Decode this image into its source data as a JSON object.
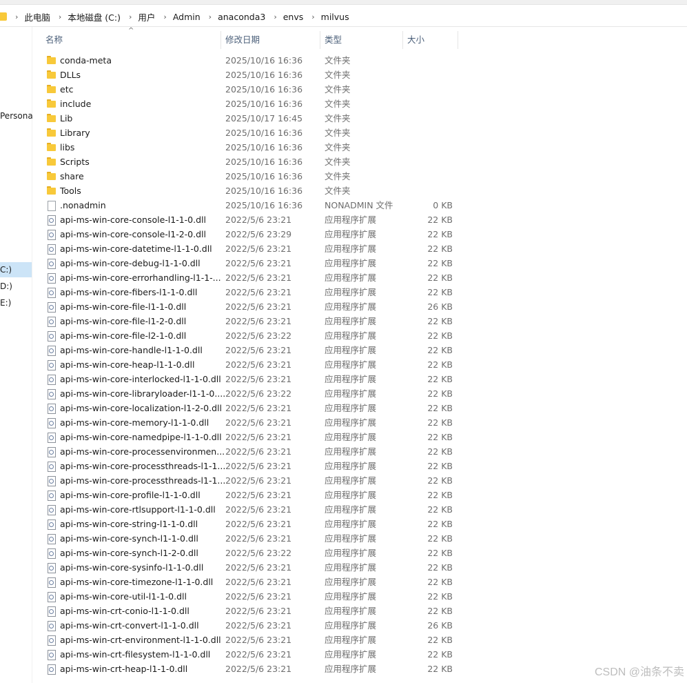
{
  "breadcrumb": [
    "此电脑",
    "本地磁盘 (C:)",
    "用户",
    "Admin",
    "anaconda3",
    "envs",
    "milvus"
  ],
  "nav": {
    "personal": "Persona",
    "drive_c": "C:)",
    "drive_d": "D:)",
    "drive_e": "E:)"
  },
  "columns": {
    "name": "名称",
    "date": "修改日期",
    "type": "类型",
    "size": "大小"
  },
  "rows": [
    {
      "icon": "folder-icon",
      "name": "conda-meta",
      "date": "2025/10/16 16:36",
      "type": "文件夹",
      "size": ""
    },
    {
      "icon": "folder-icon",
      "name": "DLLs",
      "date": "2025/10/16 16:36",
      "type": "文件夹",
      "size": ""
    },
    {
      "icon": "folder-icon",
      "name": "etc",
      "date": "2025/10/16 16:36",
      "type": "文件夹",
      "size": ""
    },
    {
      "icon": "folder-icon",
      "name": "include",
      "date": "2025/10/16 16:36",
      "type": "文件夹",
      "size": ""
    },
    {
      "icon": "folder-icon",
      "name": "Lib",
      "date": "2025/10/17 16:45",
      "type": "文件夹",
      "size": ""
    },
    {
      "icon": "folder-icon",
      "name": "Library",
      "date": "2025/10/16 16:36",
      "type": "文件夹",
      "size": ""
    },
    {
      "icon": "folder-icon",
      "name": "libs",
      "date": "2025/10/16 16:36",
      "type": "文件夹",
      "size": ""
    },
    {
      "icon": "folder-icon",
      "name": "Scripts",
      "date": "2025/10/16 16:36",
      "type": "文件夹",
      "size": ""
    },
    {
      "icon": "folder-icon",
      "name": "share",
      "date": "2025/10/16 16:36",
      "type": "文件夹",
      "size": ""
    },
    {
      "icon": "folder-icon",
      "name": "Tools",
      "date": "2025/10/16 16:36",
      "type": "文件夹",
      "size": ""
    },
    {
      "icon": "file-icon",
      "name": ".nonadmin",
      "date": "2025/10/16 16:36",
      "type": "NONADMIN 文件",
      "size": "0 KB"
    },
    {
      "icon": "dll-icon",
      "name": "api-ms-win-core-console-l1-1-0.dll",
      "date": "2022/5/6 23:21",
      "type": "应用程序扩展",
      "size": "22 KB"
    },
    {
      "icon": "dll-icon",
      "name": "api-ms-win-core-console-l1-2-0.dll",
      "date": "2022/5/6 23:29",
      "type": "应用程序扩展",
      "size": "22 KB"
    },
    {
      "icon": "dll-icon",
      "name": "api-ms-win-core-datetime-l1-1-0.dll",
      "date": "2022/5/6 23:21",
      "type": "应用程序扩展",
      "size": "22 KB"
    },
    {
      "icon": "dll-icon",
      "name": "api-ms-win-core-debug-l1-1-0.dll",
      "date": "2022/5/6 23:21",
      "type": "应用程序扩展",
      "size": "22 KB"
    },
    {
      "icon": "dll-icon",
      "name": "api-ms-win-core-errorhandling-l1-1-...",
      "date": "2022/5/6 23:21",
      "type": "应用程序扩展",
      "size": "22 KB"
    },
    {
      "icon": "dll-icon",
      "name": "api-ms-win-core-fibers-l1-1-0.dll",
      "date": "2022/5/6 23:21",
      "type": "应用程序扩展",
      "size": "22 KB"
    },
    {
      "icon": "dll-icon",
      "name": "api-ms-win-core-file-l1-1-0.dll",
      "date": "2022/5/6 23:21",
      "type": "应用程序扩展",
      "size": "26 KB"
    },
    {
      "icon": "dll-icon",
      "name": "api-ms-win-core-file-l1-2-0.dll",
      "date": "2022/5/6 23:21",
      "type": "应用程序扩展",
      "size": "22 KB"
    },
    {
      "icon": "dll-icon",
      "name": "api-ms-win-core-file-l2-1-0.dll",
      "date": "2022/5/6 23:22",
      "type": "应用程序扩展",
      "size": "22 KB"
    },
    {
      "icon": "dll-icon",
      "name": "api-ms-win-core-handle-l1-1-0.dll",
      "date": "2022/5/6 23:21",
      "type": "应用程序扩展",
      "size": "22 KB"
    },
    {
      "icon": "dll-icon",
      "name": "api-ms-win-core-heap-l1-1-0.dll",
      "date": "2022/5/6 23:21",
      "type": "应用程序扩展",
      "size": "22 KB"
    },
    {
      "icon": "dll-icon",
      "name": "api-ms-win-core-interlocked-l1-1-0.dll",
      "date": "2022/5/6 23:21",
      "type": "应用程序扩展",
      "size": "22 KB"
    },
    {
      "icon": "dll-icon",
      "name": "api-ms-win-core-libraryloader-l1-1-0....",
      "date": "2022/5/6 23:22",
      "type": "应用程序扩展",
      "size": "22 KB"
    },
    {
      "icon": "dll-icon",
      "name": "api-ms-win-core-localization-l1-2-0.dll",
      "date": "2022/5/6 23:21",
      "type": "应用程序扩展",
      "size": "22 KB"
    },
    {
      "icon": "dll-icon",
      "name": "api-ms-win-core-memory-l1-1-0.dll",
      "date": "2022/5/6 23:21",
      "type": "应用程序扩展",
      "size": "22 KB"
    },
    {
      "icon": "dll-icon",
      "name": "api-ms-win-core-namedpipe-l1-1-0.dll",
      "date": "2022/5/6 23:21",
      "type": "应用程序扩展",
      "size": "22 KB"
    },
    {
      "icon": "dll-icon",
      "name": "api-ms-win-core-processenvironmen...",
      "date": "2022/5/6 23:21",
      "type": "应用程序扩展",
      "size": "22 KB"
    },
    {
      "icon": "dll-icon",
      "name": "api-ms-win-core-processthreads-l1-1...",
      "date": "2022/5/6 23:21",
      "type": "应用程序扩展",
      "size": "22 KB"
    },
    {
      "icon": "dll-icon",
      "name": "api-ms-win-core-processthreads-l1-1...",
      "date": "2022/5/6 23:21",
      "type": "应用程序扩展",
      "size": "22 KB"
    },
    {
      "icon": "dll-icon",
      "name": "api-ms-win-core-profile-l1-1-0.dll",
      "date": "2022/5/6 23:21",
      "type": "应用程序扩展",
      "size": "22 KB"
    },
    {
      "icon": "dll-icon",
      "name": "api-ms-win-core-rtlsupport-l1-1-0.dll",
      "date": "2022/5/6 23:21",
      "type": "应用程序扩展",
      "size": "22 KB"
    },
    {
      "icon": "dll-icon",
      "name": "api-ms-win-core-string-l1-1-0.dll",
      "date": "2022/5/6 23:21",
      "type": "应用程序扩展",
      "size": "22 KB"
    },
    {
      "icon": "dll-icon",
      "name": "api-ms-win-core-synch-l1-1-0.dll",
      "date": "2022/5/6 23:21",
      "type": "应用程序扩展",
      "size": "22 KB"
    },
    {
      "icon": "dll-icon",
      "name": "api-ms-win-core-synch-l1-2-0.dll",
      "date": "2022/5/6 23:22",
      "type": "应用程序扩展",
      "size": "22 KB"
    },
    {
      "icon": "dll-icon",
      "name": "api-ms-win-core-sysinfo-l1-1-0.dll",
      "date": "2022/5/6 23:21",
      "type": "应用程序扩展",
      "size": "22 KB"
    },
    {
      "icon": "dll-icon",
      "name": "api-ms-win-core-timezone-l1-1-0.dll",
      "date": "2022/5/6 23:21",
      "type": "应用程序扩展",
      "size": "22 KB"
    },
    {
      "icon": "dll-icon",
      "name": "api-ms-win-core-util-l1-1-0.dll",
      "date": "2022/5/6 23:21",
      "type": "应用程序扩展",
      "size": "22 KB"
    },
    {
      "icon": "dll-icon",
      "name": "api-ms-win-crt-conio-l1-1-0.dll",
      "date": "2022/5/6 23:21",
      "type": "应用程序扩展",
      "size": "22 KB"
    },
    {
      "icon": "dll-icon",
      "name": "api-ms-win-crt-convert-l1-1-0.dll",
      "date": "2022/5/6 23:21",
      "type": "应用程序扩展",
      "size": "26 KB"
    },
    {
      "icon": "dll-icon",
      "name": "api-ms-win-crt-environment-l1-1-0.dll",
      "date": "2022/5/6 23:21",
      "type": "应用程序扩展",
      "size": "22 KB"
    },
    {
      "icon": "dll-icon",
      "name": "api-ms-win-crt-filesystem-l1-1-0.dll",
      "date": "2022/5/6 23:21",
      "type": "应用程序扩展",
      "size": "22 KB"
    },
    {
      "icon": "dll-icon",
      "name": "api-ms-win-crt-heap-l1-1-0.dll",
      "date": "2022/5/6 23:21",
      "type": "应用程序扩展",
      "size": "22 KB"
    }
  ],
  "watermark": "CSDN @油条不卖"
}
